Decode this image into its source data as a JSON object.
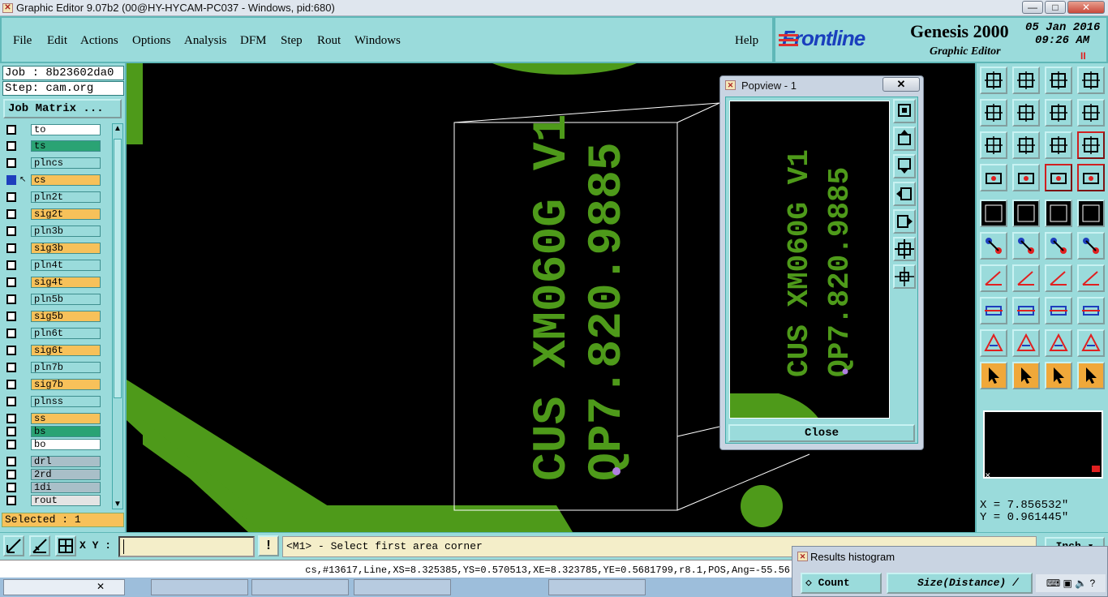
{
  "window": {
    "title": "Graphic Editor 9.07b2 (00@HY-HYCAM-PC037 - Windows, pid:680)",
    "minimize": "—",
    "maximize": "□",
    "close": "✕"
  },
  "menu": {
    "items": [
      "File",
      "Edit",
      "Actions",
      "Options",
      "Analysis",
      "DFM",
      "Step",
      "Rout",
      "Windows"
    ],
    "help": "Help"
  },
  "brand": {
    "logo": "Frontline",
    "product": "Genesis 2000",
    "subtitle": "Graphic Editor",
    "date": "05 Jan 2016",
    "time": "09:26 AM",
    "pause": "II"
  },
  "left": {
    "job": "Job : 8b23602da0",
    "step": "Step: cam.org",
    "job_matrix": "Job Matrix ...",
    "selected": "Selected : 1",
    "layers": [
      {
        "name": "to",
        "color": "#ffffff"
      },
      {
        "name": "ts",
        "color": "#2aa374"
      },
      {
        "name": "plncs",
        "color": "#9adbdb"
      },
      {
        "name": "cs",
        "color": "#f7c15a"
      },
      {
        "name": "pln2t",
        "color": "#9adbdb"
      },
      {
        "name": "sig2t",
        "color": "#f7c15a"
      },
      {
        "name": "pln3b",
        "color": "#9adbdb"
      },
      {
        "name": "sig3b",
        "color": "#f7c15a"
      },
      {
        "name": "pln4t",
        "color": "#9adbdb"
      },
      {
        "name": "sig4t",
        "color": "#f7c15a"
      },
      {
        "name": "pln5b",
        "color": "#9adbdb"
      },
      {
        "name": "sig5b",
        "color": "#f7c15a"
      },
      {
        "name": "pln6t",
        "color": "#9adbdb"
      },
      {
        "name": "sig6t",
        "color": "#f7c15a"
      },
      {
        "name": "pln7b",
        "color": "#9adbdb"
      },
      {
        "name": "sig7b",
        "color": "#f7c15a"
      },
      {
        "name": "plnss",
        "color": "#9adbdb"
      },
      {
        "name": "ss",
        "color": "#f7c15a"
      },
      {
        "name": "bs",
        "color": "#2aa374"
      },
      {
        "name": "bo",
        "color": "#ffffff"
      },
      {
        "name": "drl",
        "color": "#a9bfc8"
      },
      {
        "name": "2rd",
        "color": "#a9bfc8"
      },
      {
        "name": "1di",
        "color": "#a9bfc8"
      },
      {
        "name": "rout",
        "color": "#e4e4e4"
      }
    ]
  },
  "canvas": {
    "silk_line1": "CUS XM060G V1",
    "silk_line2": "QP7.820.9885",
    "copper_color": "#4e9a1a"
  },
  "popview": {
    "title": "Popview - 1",
    "close": "Close"
  },
  "right": {
    "x": "X = 7.856532\"",
    "y": "Y = 0.961445\""
  },
  "status": {
    "xy_label": "X Y :",
    "prompt": "<M1> - Select first area corner",
    "unit": "Inch",
    "info": "cs,#13617,Line,XS=8.325385,YS=0.570513,XE=8.323785,YE=0.5681799,r8.1,POS,Ang=-55.56"
  },
  "results": {
    "title": "Results histogram",
    "count": "Count",
    "size": "Size(Distance) /"
  }
}
